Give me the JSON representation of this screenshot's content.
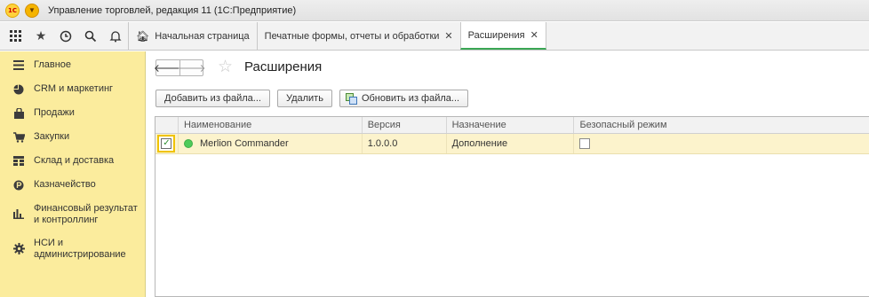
{
  "window": {
    "title": "Управление торговлей, редакция 11  (1С:Предприятие)",
    "logo_text": "1С"
  },
  "toolbar": {
    "icons": [
      "apps-grid-icon",
      "star-icon",
      "history-icon",
      "search-icon",
      "bell-icon"
    ]
  },
  "tabs": [
    {
      "label": "Начальная страница",
      "icon": "home-icon",
      "closable": false,
      "active": false
    },
    {
      "label": "Печатные формы, отчеты и обработки",
      "closable": true,
      "active": false
    },
    {
      "label": "Расширения",
      "closable": true,
      "active": true
    }
  ],
  "sidebar": {
    "items": [
      {
        "label": "Главное",
        "icon": "menu-lines-icon"
      },
      {
        "label": "CRM и маркетинг",
        "icon": "pie-chart-icon"
      },
      {
        "label": "Продажи",
        "icon": "shopping-bag-icon"
      },
      {
        "label": "Закупки",
        "icon": "cart-icon"
      },
      {
        "label": "Склад и доставка",
        "icon": "warehouse-icon"
      },
      {
        "label": "Казначейство",
        "icon": "coin-icon"
      },
      {
        "label": "Финансовый результат и контроллинг",
        "icon": "bar-chart-icon"
      },
      {
        "label": "НСИ и администрирование",
        "icon": "gear-icon"
      }
    ]
  },
  "main": {
    "title": "Расширения",
    "buttons": {
      "add": "Добавить из файла...",
      "delete": "Удалить",
      "update": "Обновить из файла..."
    },
    "table": {
      "columns": [
        "Наименование",
        "Версия",
        "Назначение",
        "Безопасный режим"
      ],
      "rows": [
        {
          "checked": true,
          "status": "active",
          "name": "Merlion Commander",
          "version": "1.0.0.0",
          "purpose": "Дополнение",
          "safe_mode": false
        }
      ]
    }
  },
  "colors": {
    "sidebar_bg": "#fbec9d",
    "active_tab_accent": "#3ba755",
    "selected_row_bg": "#fcf3cc",
    "status_dot": "#4fcb5a"
  }
}
